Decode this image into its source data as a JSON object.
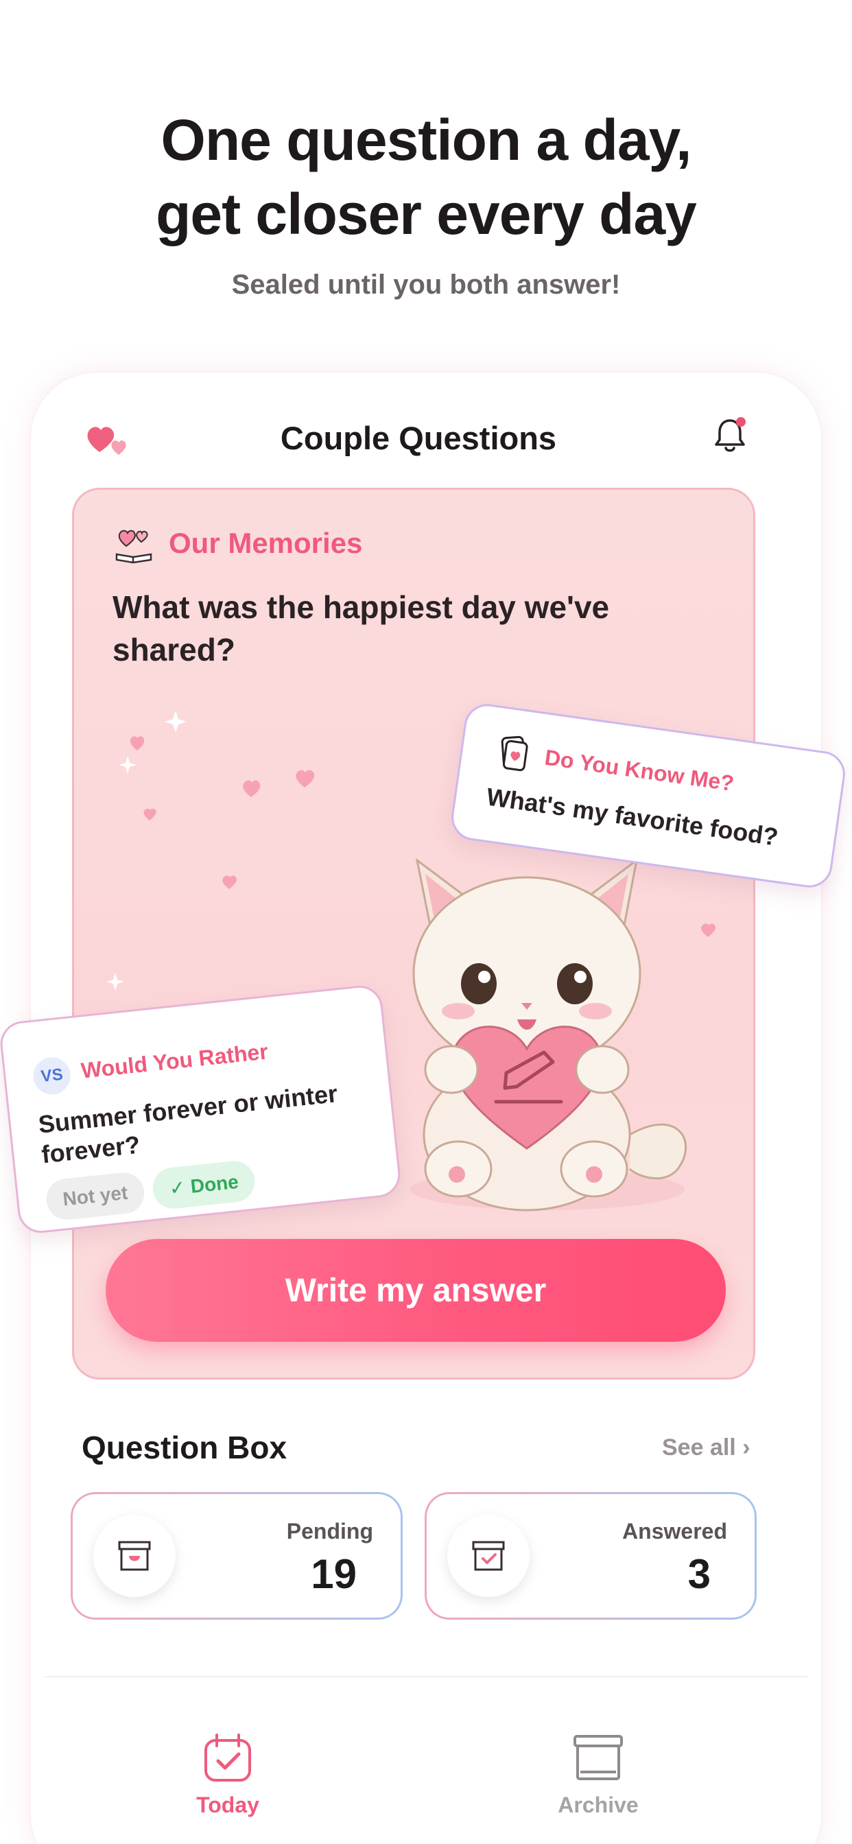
{
  "promo": {
    "headline_line1": "One question a day,",
    "headline_line2": "get closer every day",
    "subheadline": "Sealed until you both answer!"
  },
  "app": {
    "title": "Couple Questions",
    "logo_icon": "hearts-icon",
    "notification_icon": "bell-icon",
    "has_notification": true
  },
  "question_card": {
    "category": "Our Memories",
    "category_icon": "memory-book-icon",
    "question": "What was the happiest day we've shared?",
    "answer_button": "Write my answer"
  },
  "floating_cards": {
    "know_me": {
      "category": "Do You Know Me?",
      "icon": "cards-icon",
      "question": "What's my favorite food?"
    },
    "would_you_rather": {
      "badge": "VS",
      "category": "Would You Rather",
      "question": "Summer forever or winter forever?",
      "status_not_yet": "Not yet",
      "status_done": "✓ Done"
    }
  },
  "question_box": {
    "title": "Question Box",
    "see_all": "See all ›",
    "pending": {
      "label": "Pending",
      "count": "19",
      "icon": "inbox-heart-icon"
    },
    "answered": {
      "label": "Answered",
      "count": "3",
      "icon": "inbox-check-icon"
    }
  },
  "tabs": [
    {
      "label": "Today",
      "icon": "calendar-check-icon",
      "active": true
    },
    {
      "label": "Archive",
      "icon": "archive-box-icon",
      "active": false
    }
  ],
  "colors": {
    "accent": "#ef5a7c",
    "button_gradient_start": "#ff7795",
    "button_gradient_end": "#ff4d75",
    "card_background": "#fbdcdc",
    "done_green": "#2fa85a"
  }
}
